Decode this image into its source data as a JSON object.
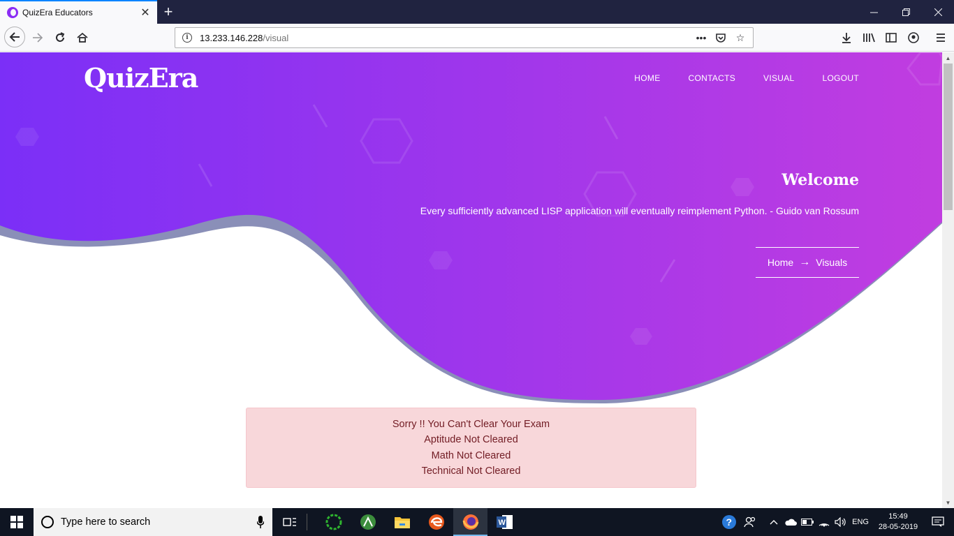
{
  "browser": {
    "tab_title": "QuizEra Educators",
    "url_host": "13.233.146.228",
    "url_path": "/visual",
    "page_actions": "•••"
  },
  "site": {
    "logo": "QuizEra",
    "menu": [
      {
        "label": "HOME"
      },
      {
        "label": "CONTACTS"
      },
      {
        "label": "VISUAL"
      },
      {
        "label": "LOGOUT"
      }
    ],
    "welcome_title": "Welcome",
    "quote": "Every sufficiently advanced LISP application will eventually reimplement Python. - Guido van Rossum",
    "breadcrumb": {
      "home": "Home",
      "current": "Visuals"
    },
    "gradient": {
      "start": "#7b2ff7",
      "end": "#c13de0"
    }
  },
  "alert": {
    "lines": [
      "Sorry !! You Can't Clear Your Exam",
      "Aptitude Not Cleared",
      "Math Not Cleared",
      "Technical Not Cleared"
    ],
    "bg": "#f8d7da",
    "color": "#721c24"
  },
  "taskbar": {
    "search_placeholder": "Type here to search",
    "language": "ENG",
    "time": "15:49",
    "date": "28-05-2019"
  }
}
